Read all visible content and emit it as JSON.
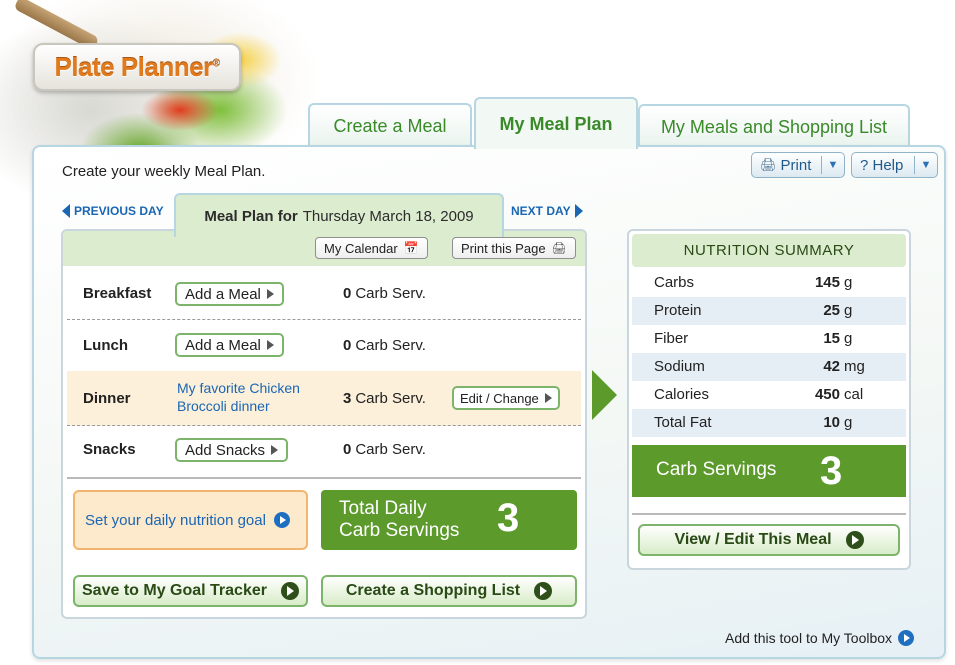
{
  "logo": {
    "text": "Plate Planner",
    "mark": "®"
  },
  "tabs": [
    {
      "label": "Create a Meal",
      "active": false
    },
    {
      "label": "My Meal Plan",
      "active": true
    },
    {
      "label": "My Meals and Shopping List",
      "active": false
    }
  ],
  "intro": "Create your weekly Meal Plan.",
  "toolbar": {
    "print_label": "Print",
    "help_label": "? Help"
  },
  "day_nav": {
    "previous": "PREVIOUS DAY",
    "next": "NEXT DAY",
    "title_prefix": "Meal Plan for",
    "date": "Thursday March 18, 2009"
  },
  "plan_toolbar": {
    "calendar": "My Calendar",
    "print_page": "Print this Page"
  },
  "meals": {
    "breakfast": {
      "name": "Breakfast",
      "action": "Add a Meal",
      "carb_count": "0",
      "carb_unit": "Carb Serv."
    },
    "lunch": {
      "name": "Lunch",
      "action": "Add a Meal",
      "carb_count": "0",
      "carb_unit": "Carb Serv."
    },
    "dinner": {
      "name": "Dinner",
      "meal_link": "My favorite Chicken Broccoli dinner",
      "carb_count": "3",
      "carb_unit": "Carb Serv.",
      "action": "Edit / Change"
    },
    "snacks": {
      "name": "Snacks",
      "action": "Add Snacks",
      "carb_count": "0",
      "carb_unit": "Carb Serv."
    }
  },
  "goal_link": "Set your daily nutrition goal",
  "total": {
    "line1": "Total Daily",
    "line2": "Carb Servings",
    "value": "3"
  },
  "buttons": {
    "goal_tracker": "Save to My Goal Tracker",
    "shopping_list": "Create a Shopping List",
    "view_edit": "View / Edit This Meal"
  },
  "nutrition": {
    "title": "NUTRITION SUMMARY",
    "rows": [
      {
        "name": "Carbs",
        "value": "145",
        "unit": "g"
      },
      {
        "name": "Protein",
        "value": "25",
        "unit": "g"
      },
      {
        "name": "Fiber",
        "value": "15",
        "unit": "g"
      },
      {
        "name": "Sodium",
        "value": "42",
        "unit": "mg"
      },
      {
        "name": "Calories",
        "value": "450",
        "unit": "cal"
      },
      {
        "name": "Total Fat",
        "value": "10",
        "unit": "g"
      }
    ],
    "carb_servings_label": "Carb Servings",
    "carb_servings_value": "3"
  },
  "footer": {
    "toolbox_link": "Add this tool to My Toolbox"
  },
  "colors": {
    "accent_green": "#5c9a2c",
    "link_blue": "#1a66b3",
    "tab_border": "#b6d6e2",
    "highlight": "#fdf0da"
  }
}
